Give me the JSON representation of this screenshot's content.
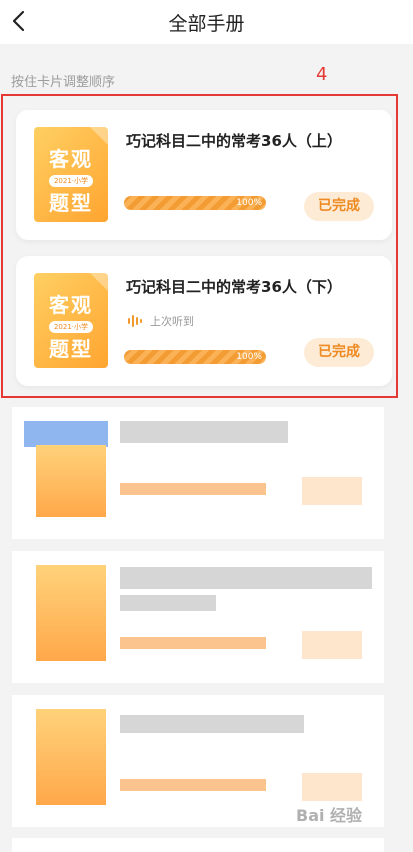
{
  "header": {
    "title": "全部手册",
    "back_icon": "chevron-left-icon"
  },
  "hint": "按住卡片调整顺序",
  "annotation": {
    "number": "4",
    "color": "#e53935"
  },
  "cards": [
    {
      "cover": {
        "line1": "客观",
        "badge": "2021·小学",
        "line2": "题型"
      },
      "title": "巧记科目二中的常考36人（上）",
      "progress": 1.0,
      "progress_label": "100%",
      "status": "已完成"
    },
    {
      "cover": {
        "line1": "客观",
        "badge": "2021·小学",
        "line2": "题型"
      },
      "title": "巧记科目二中的常考36人（下）",
      "last_listen": "上次听到",
      "progress": 1.0,
      "progress_label": "100%",
      "status": "已完成"
    }
  ],
  "colors": {
    "accent": "#f39a2e",
    "done_bg": "#fdebd5",
    "done_text": "#ee8a22"
  },
  "watermark": "Bai 经验"
}
